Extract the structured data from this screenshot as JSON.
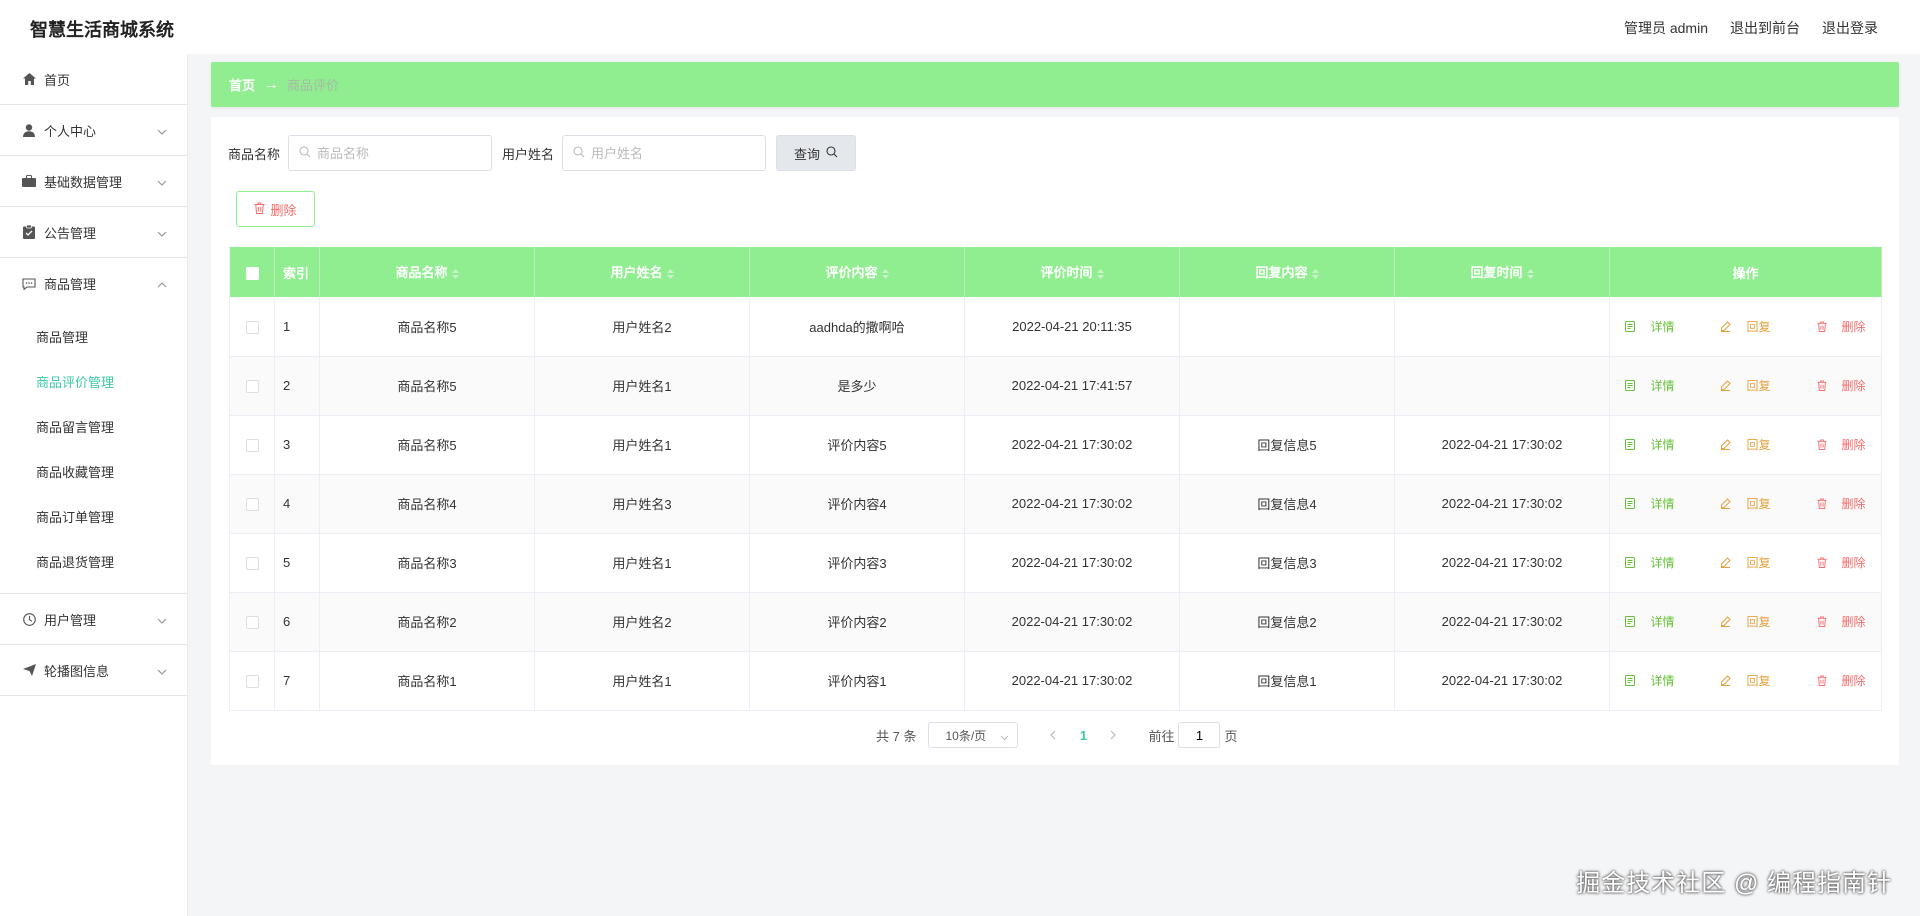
{
  "header": {
    "app_title": "智慧生活商城系统",
    "user_label": "管理员 admin",
    "exit_front_label": "退出到前台",
    "logout_label": "退出登录"
  },
  "sidebar": {
    "items": [
      {
        "label": "首页",
        "icon": "home-icon"
      },
      {
        "label": "个人中心",
        "icon": "user-icon"
      },
      {
        "label": "基础数据管理",
        "icon": "briefcase-icon"
      },
      {
        "label": "公告管理",
        "icon": "clipboard-icon"
      },
      {
        "label": "商品管理",
        "icon": "chat-icon"
      },
      {
        "label": "用户管理",
        "icon": "clock-icon"
      },
      {
        "label": "轮播图信息",
        "icon": "send-icon"
      }
    ],
    "sub_items": [
      "商品管理",
      "商品评价管理",
      "商品留言管理",
      "商品收藏管理",
      "商品订单管理",
      "商品退货管理"
    ]
  },
  "breadcrumb": {
    "home": "首页",
    "current": "商品评价"
  },
  "search": {
    "product_label": "商品名称",
    "product_placeholder": "商品名称",
    "user_label": "用户姓名",
    "user_placeholder": "用户姓名",
    "query_label": "查询"
  },
  "toolbar": {
    "delete_label": "删除"
  },
  "table": {
    "headers": [
      "索引",
      "商品名称",
      "用户姓名",
      "评价内容",
      "评价时间",
      "回复内容",
      "回复时间",
      "操作"
    ],
    "actions": {
      "detail": "详情",
      "reply": "回复",
      "delete": "删除"
    },
    "rows": [
      [
        "1",
        "商品名称5",
        "用户姓名2",
        "aadhda的撒啊哈",
        "2022-04-21 20:11:35",
        "",
        ""
      ],
      [
        "2",
        "商品名称5",
        "用户姓名1",
        "是多少",
        "2022-04-21 17:41:57",
        "",
        ""
      ],
      [
        "3",
        "商品名称5",
        "用户姓名1",
        "评价内容5",
        "2022-04-21 17:30:02",
        "回复信息5",
        "2022-04-21 17:30:02"
      ],
      [
        "4",
        "商品名称4",
        "用户姓名3",
        "评价内容4",
        "2022-04-21 17:30:02",
        "回复信息4",
        "2022-04-21 17:30:02"
      ],
      [
        "5",
        "商品名称3",
        "用户姓名1",
        "评价内容3",
        "2022-04-21 17:30:02",
        "回复信息3",
        "2022-04-21 17:30:02"
      ],
      [
        "6",
        "商品名称2",
        "用户姓名2",
        "评价内容2",
        "2022-04-21 17:30:02",
        "回复信息2",
        "2022-04-21 17:30:02"
      ],
      [
        "7",
        "商品名称1",
        "用户姓名1",
        "评价内容1",
        "2022-04-21 17:30:02",
        "回复信息1",
        "2022-04-21 17:30:02"
      ]
    ]
  },
  "pagination": {
    "total": "共 7 条",
    "page_size": "10条/页",
    "current_page": "1",
    "goto_label": "前往",
    "goto_value": "1",
    "page_suffix": "页"
  },
  "watermark": "掘金技术社区 @ 编程指南针",
  "colors": {
    "accent_green": "#90ee90",
    "active_teal": "#3cc8a8",
    "danger": "#f56c6c",
    "warning": "#e6a23c",
    "success": "#67c23a"
  }
}
